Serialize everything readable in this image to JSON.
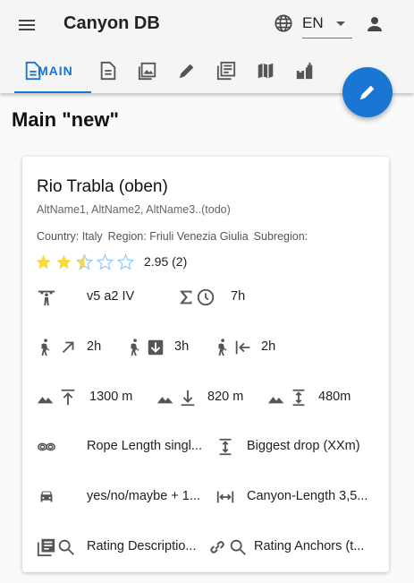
{
  "app": {
    "title": "Canyon DB",
    "language": "EN"
  },
  "tabs": [
    {
      "label": "MAIN",
      "icon": "document-icon"
    },
    {
      "label": "",
      "icon": "description-icon"
    },
    {
      "label": "",
      "icon": "images-icon"
    },
    {
      "label": "",
      "icon": "edit-icon"
    },
    {
      "label": "",
      "icon": "library-books-icon"
    },
    {
      "label": "",
      "icon": "map-icon"
    },
    {
      "label": "",
      "icon": "castle-icon"
    }
  ],
  "page": {
    "title": "Main \"new\""
  },
  "card": {
    "name": "Rio Trabla (oben)",
    "alt_names": "AltName1, AltName2, AltName3..(todo)",
    "country": "Country: Italy",
    "region": "Region: Friuli Venezia Giulia",
    "subregion": "Subregion:",
    "rating": {
      "stars": 2.5,
      "max": 5,
      "value_text": "2.95 (2)"
    },
    "difficulty": "v5 a2 IV",
    "total_time": "7h",
    "approach_time": "2h",
    "descent_time": "3h",
    "exit_time": "2h",
    "ascent": "1300 m",
    "descent": "820 m",
    "height_difference": "480m",
    "rope_length": "Rope Length singl...",
    "biggest_drop": "Biggest drop (XXm)",
    "shuttle": "yes/no/maybe + 1...",
    "canyon_length": "Canyon-Length 3,5...",
    "rating_description": "Rating Descriptio...",
    "rating_anchors": "Rating Anchors (t..."
  },
  "colors": {
    "primary": "#1976d2",
    "star": "#fdd835",
    "star_empty": "#90caf9",
    "icon": "#555555"
  }
}
